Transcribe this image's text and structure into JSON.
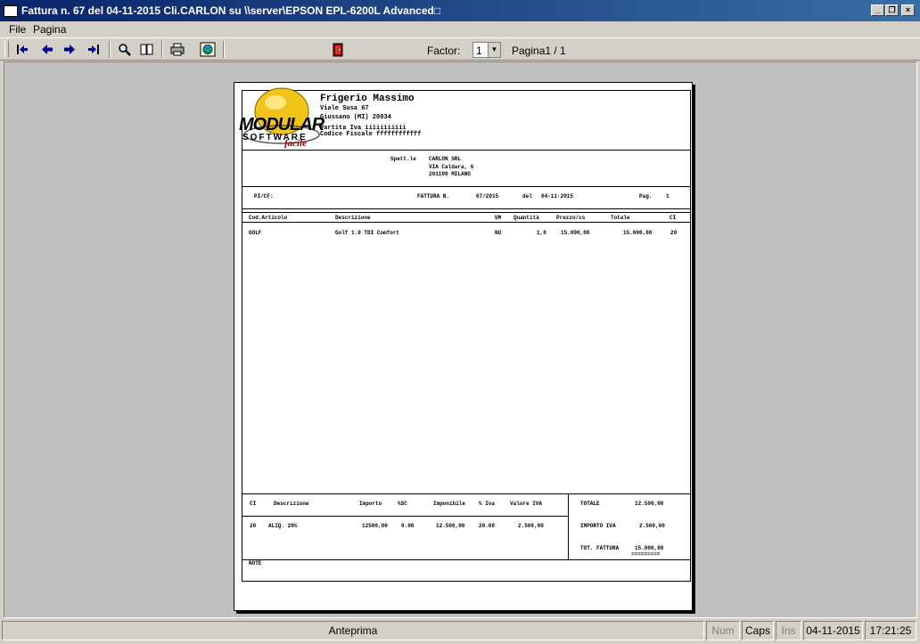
{
  "window": {
    "title": "Fattura n.  67 del 04-11-2015 Cli.CARLON su \\\\server\\EPSON EPL-6200L Advanced□"
  },
  "menu": [
    "File",
    "Pagina"
  ],
  "toolbar": {
    "factor_label": "Factor:",
    "factor_value": "1",
    "page_label": "Pagina1 / 1"
  },
  "invoice": {
    "logo": {
      "line1": "MODULAR",
      "line2": "SOFTWARE",
      "line3": "facile"
    },
    "company": {
      "name": "Frigerio Massimo",
      "address": "Viale Susa 67",
      "city": "Giussano (MI) 20034",
      "vat": "Partita Iva  iiiiiiiiiii",
      "fiscal_code": "Codice Fiscale  ffffffffffff"
    },
    "recipient": {
      "label": "Spett.le",
      "name": "CARLON SRL",
      "street": "VIA Caldara, 6",
      "city": "201100  MILANO"
    },
    "info": {
      "pi_cf": "PI/CF:",
      "type": "FATTURA  N.",
      "number": "67/2015",
      "date_label": "del",
      "date": "04-11-2015",
      "page_label": "Pag.",
      "page": "1"
    },
    "columns": [
      "Cod.Articolo",
      "Descrizione",
      "UM",
      "Quantità",
      "Prezzo/cs",
      "Totale",
      "CI"
    ],
    "rows": [
      {
        "code": "GOLF",
        "description": "Golf 1.9 TDI Comfort",
        "um": "NU",
        "qty": "1,0",
        "price": "15.000,00",
        "total": "15.000,00",
        "ci": "20"
      }
    ],
    "vat_columns": [
      "CI",
      "Descrizione",
      "Importo",
      "%SC",
      "Imponibile",
      "% Iva",
      "Valore IVA"
    ],
    "vat_row": {
      "ci": "20",
      "description": "ALIQ. 20%",
      "amount": "12500,00",
      "discount": "0.00",
      "taxable": "12.500,00",
      "rate": "20.00",
      "vat_value": "2.500,00"
    },
    "totals": {
      "total_label": "TOTALE",
      "total": "12.500,00",
      "vat_label": "IMPORTO IVA",
      "vat": "2.500,00",
      "grand_label": "TOT. FATTURA",
      "grand": "15.000,00",
      "underline": "========="
    },
    "notes_label": "NOTE"
  },
  "status": {
    "main": "Anteprima",
    "num": "Num",
    "caps": "Caps",
    "ins": "Ins",
    "date": "04-11-2015",
    "time": "17:21:25"
  }
}
